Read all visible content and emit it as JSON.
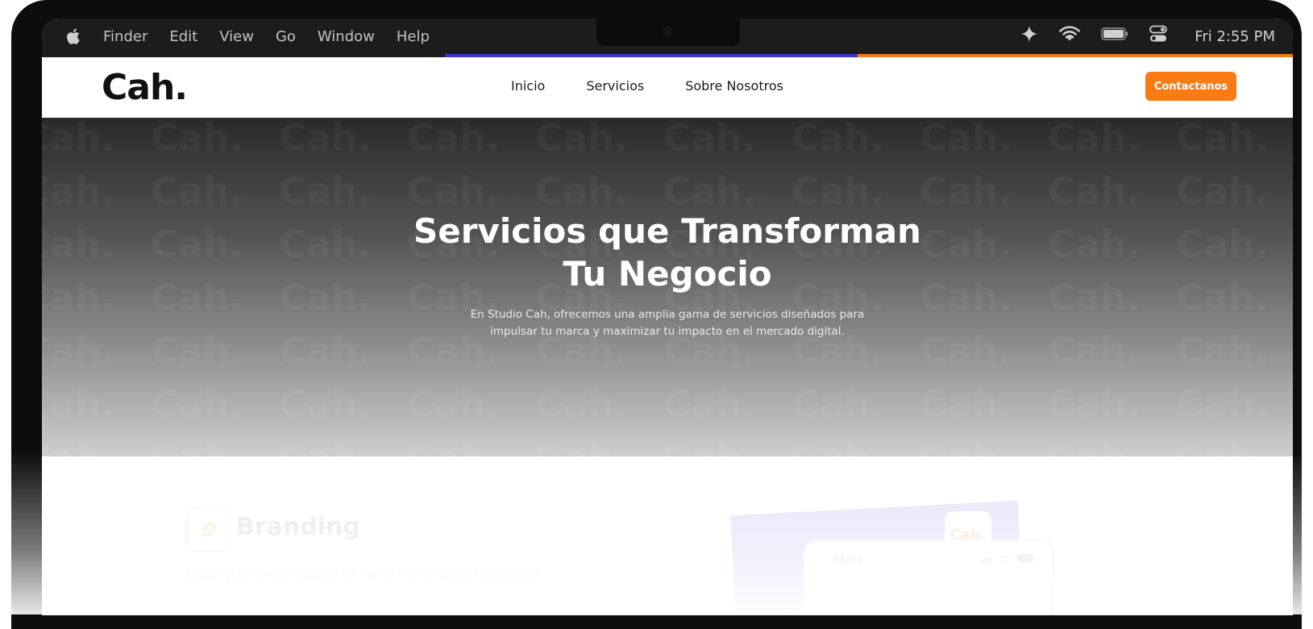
{
  "menubar": {
    "items": [
      "Finder",
      "Edit",
      "View",
      "Go",
      "Window",
      "Help"
    ],
    "clock": "Fri 2:55 PM",
    "icons": [
      "apple-icon",
      "sparkle-icon",
      "wifi-icon",
      "battery-icon",
      "control-center-icon"
    ]
  },
  "site": {
    "logo": "Cah.",
    "nav": [
      "Inicio",
      "Servicios",
      "Sobre Nosotros"
    ],
    "cta": "Contactanos",
    "accent": "#f97b14",
    "accent2": "#3b35d0"
  },
  "hero": {
    "title_line1": "Servicios que Transforman",
    "title_line2": "Tu Negocio",
    "subtitle_line1": "En Studio Cah, ofrecemos una amplia gama de servicios diseñados para",
    "subtitle_line2": "impulsar tu marca y maximizar tu impacto en el mercado digital.",
    "watermark": "Cah."
  },
  "service": {
    "title": "Branding",
    "description": "Desarrollamos identidades de marca memorables, fusionando",
    "icon": "pen-tool-icon",
    "mockup_time": "11:01",
    "mockup_logo": "Cah."
  }
}
